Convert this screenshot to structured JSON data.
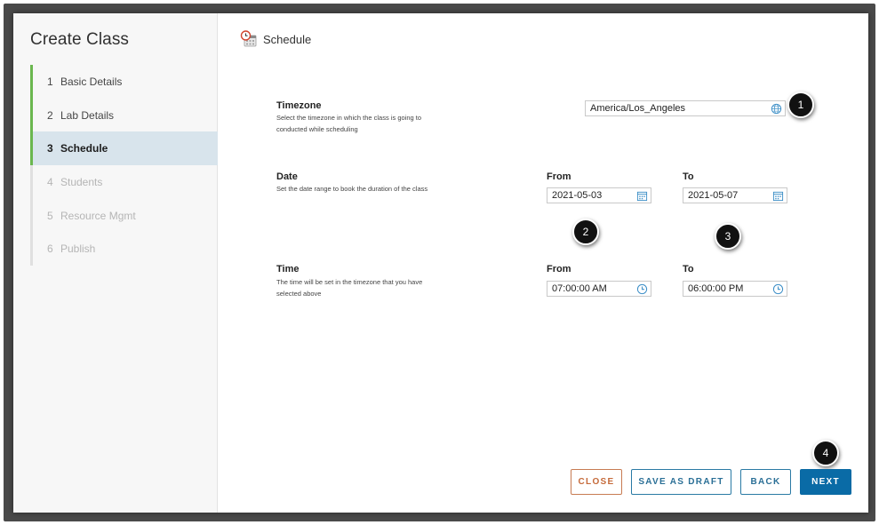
{
  "modal": {
    "title": "Create Class"
  },
  "steps": [
    {
      "num": "1",
      "label": "Basic Details"
    },
    {
      "num": "2",
      "label": "Lab Details"
    },
    {
      "num": "3",
      "label": "Schedule"
    },
    {
      "num": "4",
      "label": "Students"
    },
    {
      "num": "5",
      "label": "Resource Mgmt"
    },
    {
      "num": "6",
      "label": "Publish"
    }
  ],
  "section": {
    "title": "Schedule",
    "icon": "calendar-clock-icon"
  },
  "timezone": {
    "label": "Timezone",
    "description": "Select the timezone in which the class is going to conducted while scheduling",
    "value": "America/Los_Angeles",
    "icon": "globe-icon"
  },
  "date": {
    "label": "Date",
    "description": "Set the date range to book the duration of the class",
    "from_label": "From",
    "from_value": "2021-05-03",
    "to_label": "To",
    "to_value": "2021-05-07"
  },
  "time": {
    "label": "Time",
    "description": "The time will be set in the timezone that you have selected above",
    "from_label": "From",
    "from_value": "07:00:00 AM",
    "to_label": "To",
    "to_value": "06:00:00 PM"
  },
  "badges": [
    "1",
    "2",
    "3",
    "4"
  ],
  "buttons": {
    "close": "CLOSE",
    "save_draft": "SAVE AS DRAFT",
    "back": "BACK",
    "next": "NEXT"
  },
  "colors": {
    "primary": "#0a6ba6",
    "close_accent": "#c56a3a",
    "active_step_bg": "#d8e4ec",
    "progress_green": "#6bb74f"
  }
}
